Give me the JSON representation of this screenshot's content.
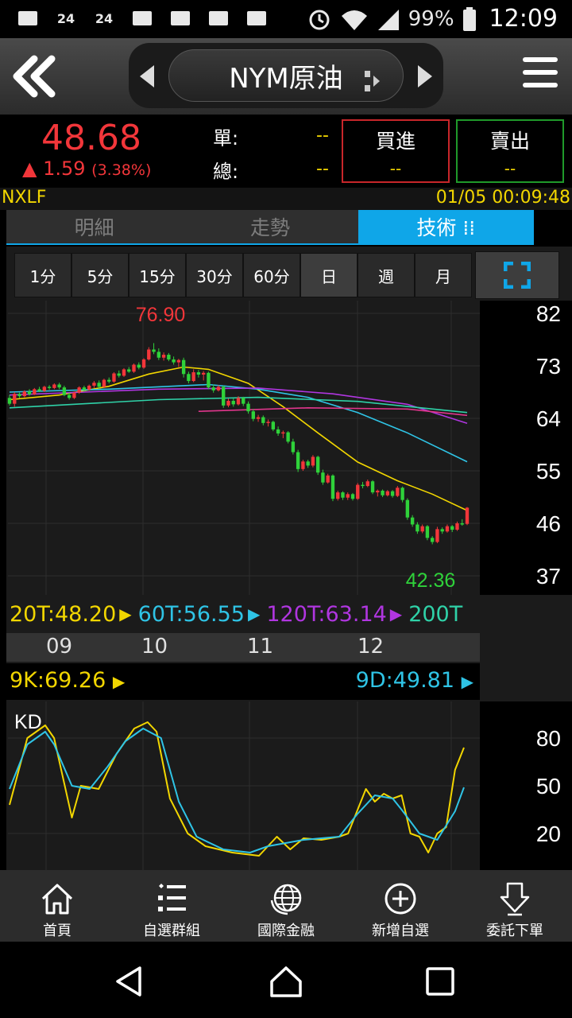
{
  "status_bar": {
    "left_icons": [
      "mail-icon",
      "24h-icon",
      "24h-icon",
      "chat-icon",
      "image-icon",
      "barcode-icon",
      "pinwheel-icon"
    ],
    "left_labels": [
      "",
      "24",
      "24",
      "",
      "",
      "",
      ""
    ],
    "battery": "99%",
    "time": "12:09"
  },
  "header": {
    "title": "NYM原油"
  },
  "quote": {
    "price": "48.68",
    "change": "▲ 1.59",
    "change_pct": "(3.38%)",
    "single_label": "單:",
    "single_value": "--",
    "total_label": "總:",
    "total_value": "--",
    "buy_label": "買進",
    "buy_value": "--",
    "sell_label": "賣出",
    "sell_value": "--"
  },
  "info": {
    "symbol": "NXLF",
    "datetime": "01/05 00:09:48"
  },
  "tabs": [
    {
      "label": "明細"
    },
    {
      "label": "走勢"
    },
    {
      "label": "技術 ⁞⁞"
    }
  ],
  "intervals": [
    "1分",
    "5分",
    "15分",
    "30分",
    "60分",
    "日",
    "週",
    "月"
  ],
  "selected_interval": "日",
  "colors": {
    "up": "#f2363a",
    "down": "#2fd23a",
    "ma20": "#f2d600",
    "ma60": "#2fc4e6",
    "ma120": "#b036e0",
    "ma200": "#2fd2a8",
    "ma_pink": "#e0368c",
    "accent": "#0fa6e8"
  },
  "ma_legend": [
    {
      "text": "20T:48.20",
      "color": "#f2d600"
    },
    {
      "text": "60T:56.55",
      "color": "#2fc4e6"
    },
    {
      "text": "120T:63.14",
      "color": "#b036e0"
    },
    {
      "text": "200T",
      "color": "#2fd2a8"
    }
  ],
  "months": [
    "09",
    "10",
    "11",
    "12"
  ],
  "kd": {
    "k_label": "9K:69.26",
    "d_label": "9D:49.81",
    "title": "KD"
  },
  "bottom_nav": [
    {
      "label": "首頁",
      "icon": "home-icon"
    },
    {
      "label": "自選群組",
      "icon": "list-icon"
    },
    {
      "label": "國際金融",
      "icon": "globe-icon"
    },
    {
      "label": "新增自選",
      "icon": "add-circle-icon"
    },
    {
      "label": "委託下單",
      "icon": "order-down-icon"
    }
  ],
  "chart_data": [
    {
      "type": "candlestick",
      "title": "",
      "ylim": [
        37,
        82
      ],
      "y_ticks": [
        82,
        73,
        64,
        55,
        46,
        37
      ],
      "x_labels": [
        "09",
        "10",
        "11",
        "12"
      ],
      "high_label": "76.90",
      "low_label": "42.36",
      "candles": [
        [
          67.5,
          68.0,
          66.2,
          66.5
        ],
        [
          66.5,
          68.5,
          66.0,
          68.2
        ],
        [
          68.2,
          68.4,
          67.5,
          67.8
        ],
        [
          67.8,
          68.8,
          67.6,
          68.6
        ],
        [
          68.6,
          69.0,
          67.9,
          68.1
        ],
        [
          68.1,
          69.2,
          68.0,
          69.0
        ],
        [
          69.0,
          69.4,
          68.5,
          68.7
        ],
        [
          68.7,
          69.6,
          68.5,
          69.4
        ],
        [
          69.4,
          69.7,
          68.9,
          69.2
        ],
        [
          69.2,
          70.0,
          69.0,
          69.8
        ],
        [
          69.8,
          70.1,
          69.0,
          69.3
        ],
        [
          69.3,
          69.6,
          67.8,
          68.0
        ],
        [
          68.0,
          68.4,
          67.2,
          67.5
        ],
        [
          67.5,
          68.6,
          67.3,
          68.4
        ],
        [
          68.4,
          69.5,
          68.2,
          69.3
        ],
        [
          69.3,
          69.6,
          68.6,
          68.9
        ],
        [
          68.9,
          69.8,
          68.7,
          69.6
        ],
        [
          69.6,
          70.4,
          69.2,
          70.1
        ],
        [
          70.1,
          70.5,
          69.1,
          69.4
        ],
        [
          69.4,
          70.8,
          69.2,
          70.6
        ],
        [
          70.6,
          71.0,
          70.0,
          70.3
        ],
        [
          70.3,
          71.9,
          70.1,
          71.7
        ],
        [
          71.7,
          72.2,
          71.0,
          71.3
        ],
        [
          71.3,
          72.6,
          71.1,
          72.4
        ],
        [
          72.4,
          72.8,
          71.8,
          72.0
        ],
        [
          72.0,
          73.4,
          71.8,
          73.2
        ],
        [
          73.2,
          73.6,
          72.4,
          72.7
        ],
        [
          72.7,
          74.3,
          72.5,
          74.1
        ],
        [
          74.1,
          76.2,
          73.9,
          75.8
        ],
        [
          75.8,
          76.9,
          75.0,
          75.4
        ],
        [
          75.4,
          76.0,
          74.0,
          74.4
        ],
        [
          74.4,
          75.3,
          73.9,
          74.9
        ],
        [
          74.9,
          75.2,
          73.8,
          74.1
        ],
        [
          74.1,
          74.6,
          73.2,
          73.6
        ],
        [
          73.6,
          74.2,
          72.8,
          74.0
        ],
        [
          74.0,
          74.4,
          71.0,
          71.6
        ],
        [
          71.6,
          72.0,
          70.0,
          70.4
        ],
        [
          70.4,
          72.4,
          70.2,
          71.9
        ],
        [
          71.9,
          72.3,
          71.0,
          71.5
        ],
        [
          71.5,
          72.1,
          70.5,
          71.8
        ],
        [
          71.8,
          72.0,
          69.0,
          69.3
        ],
        [
          69.3,
          69.8,
          68.4,
          68.8
        ],
        [
          68.8,
          69.7,
          68.6,
          69.4
        ],
        [
          69.4,
          69.6,
          65.8,
          66.2
        ],
        [
          66.2,
          67.4,
          65.9,
          67.0
        ],
        [
          67.0,
          67.4,
          66.0,
          66.4
        ],
        [
          66.4,
          67.8,
          66.2,
          67.5
        ],
        [
          67.5,
          67.7,
          66.1,
          66.5
        ],
        [
          66.5,
          66.9,
          64.8,
          65.2
        ],
        [
          65.2,
          65.6,
          63.5,
          63.9
        ],
        [
          63.9,
          64.6,
          63.4,
          64.2
        ],
        [
          64.2,
          64.5,
          62.8,
          63.2
        ],
        [
          63.2,
          63.8,
          62.6,
          63.4
        ],
        [
          63.4,
          63.6,
          61.8,
          62.1
        ],
        [
          62.1,
          62.6,
          61.0,
          61.4
        ],
        [
          61.4,
          61.9,
          60.6,
          61.6
        ],
        [
          61.6,
          61.8,
          59.7,
          60.0
        ],
        [
          60.0,
          60.5,
          57.8,
          58.2
        ],
        [
          58.2,
          58.6,
          54.8,
          55.3
        ],
        [
          55.3,
          56.9,
          55.0,
          56.6
        ],
        [
          56.6,
          56.9,
          55.5,
          55.9
        ],
        [
          55.9,
          57.7,
          55.6,
          57.4
        ],
        [
          57.4,
          57.6,
          54.3,
          54.7
        ],
        [
          54.7,
          55.2,
          52.6,
          53.0
        ],
        [
          53.0,
          54.5,
          52.8,
          54.2
        ],
        [
          54.2,
          54.4,
          49.8,
          50.2
        ],
        [
          50.2,
          51.6,
          49.9,
          51.3
        ],
        [
          51.3,
          51.5,
          50.0,
          50.4
        ],
        [
          50.4,
          51.3,
          50.0,
          51.0
        ],
        [
          51.0,
          51.2,
          49.9,
          50.2
        ],
        [
          50.2,
          52.9,
          50.0,
          52.6
        ],
        [
          52.6,
          53.1,
          52.0,
          52.4
        ],
        [
          52.4,
          53.5,
          52.2,
          53.2
        ],
        [
          53.2,
          53.4,
          51.0,
          51.3
        ],
        [
          51.3,
          51.8,
          50.6,
          51.6
        ],
        [
          51.6,
          51.8,
          50.5,
          50.8
        ],
        [
          50.8,
          51.7,
          50.6,
          51.5
        ],
        [
          51.5,
          51.7,
          50.4,
          50.7
        ],
        [
          50.7,
          52.4,
          50.5,
          52.1
        ],
        [
          52.1,
          52.3,
          49.6,
          50.0
        ],
        [
          50.0,
          50.3,
          46.6,
          47.0
        ],
        [
          47.0,
          47.4,
          45.4,
          45.8
        ],
        [
          45.8,
          46.2,
          44.2,
          44.6
        ],
        [
          44.6,
          45.8,
          44.3,
          45.5
        ],
        [
          45.5,
          45.7,
          43.1,
          43.5
        ],
        [
          43.5,
          43.8,
          42.4,
          42.8
        ],
        [
          42.8,
          45.4,
          42.6,
          45.0
        ],
        [
          45.0,
          45.3,
          44.2,
          44.6
        ],
        [
          44.6,
          45.8,
          44.4,
          45.5
        ],
        [
          45.5,
          45.7,
          44.5,
          44.9
        ],
        [
          44.9,
          46.3,
          44.7,
          46.0
        ],
        [
          46.0,
          46.7,
          45.6,
          45.9
        ],
        [
          45.9,
          48.8,
          45.7,
          48.68
        ]
      ],
      "ma_lines": [
        {
          "name": "20T",
          "color": "#f2d600",
          "values": [
            [
              0,
              67.2
            ],
            [
              10,
              68.0
            ],
            [
              20,
              69.5
            ],
            [
              28,
              71.6
            ],
            [
              35,
              72.8
            ],
            [
              40,
              72.4
            ],
            [
              48,
              70.0
            ],
            [
              55,
              66.0
            ],
            [
              62,
              61.5
            ],
            [
              70,
              56.5
            ],
            [
              78,
              53.3
            ],
            [
              85,
              51.0
            ],
            [
              92,
              48.2
            ]
          ]
        },
        {
          "name": "60T",
          "color": "#2fc4e6",
          "values": [
            [
              0,
              68.5
            ],
            [
              20,
              69.0
            ],
            [
              40,
              69.8
            ],
            [
              50,
              69.0
            ],
            [
              60,
              67.6
            ],
            [
              70,
              65.0
            ],
            [
              80,
              61.5
            ],
            [
              92,
              56.55
            ]
          ]
        },
        {
          "name": "120T",
          "color": "#b036e0",
          "values": [
            [
              0,
              68.0
            ],
            [
              30,
              69.0
            ],
            [
              50,
              69.2
            ],
            [
              65,
              68.2
            ],
            [
              80,
              66.4
            ],
            [
              92,
              63.14
            ]
          ]
        },
        {
          "name": "200T",
          "color": "#2fd2a8",
          "values": [
            [
              0,
              65.8
            ],
            [
              30,
              67.2
            ],
            [
              50,
              67.6
            ],
            [
              70,
              66.9
            ],
            [
              92,
              65.0
            ]
          ]
        },
        {
          "name": "",
          "color": "#e0368c",
          "values": [
            [
              38,
              65.2
            ],
            [
              60,
              65.8
            ],
            [
              80,
              65.6
            ],
            [
              92,
              64.5
            ]
          ]
        }
      ]
    },
    {
      "type": "line",
      "title": "KD",
      "ylim": [
        0,
        100
      ],
      "y_ticks": [
        80,
        50,
        20
      ],
      "series": [
        {
          "name": "9K",
          "color": "#f2d600",
          "values": [
            [
              0,
              38
            ],
            [
              4,
              80
            ],
            [
              8,
              88
            ],
            [
              10,
              80
            ],
            [
              14,
              30
            ],
            [
              16,
              50
            ],
            [
              20,
              48
            ],
            [
              24,
              70
            ],
            [
              28,
              86
            ],
            [
              31,
              90
            ],
            [
              33,
              84
            ],
            [
              36,
              42
            ],
            [
              40,
              20
            ],
            [
              44,
              12
            ],
            [
              50,
              8
            ],
            [
              56,
              6
            ],
            [
              60,
              18
            ],
            [
              63,
              10
            ],
            [
              66,
              17
            ],
            [
              70,
              16
            ],
            [
              74,
              18
            ],
            [
              76,
              20
            ],
            [
              80,
              48
            ],
            [
              82,
              40
            ],
            [
              84,
              45
            ],
            [
              86,
              42
            ],
            [
              88,
              44
            ],
            [
              90,
              20
            ],
            [
              92,
              18
            ],
            [
              94,
              8
            ],
            [
              96,
              20
            ],
            [
              98,
              24
            ],
            [
              100,
              60
            ],
            [
              102,
              74
            ]
          ]
        },
        {
          "name": "9D",
          "color": "#2fc4e6",
          "values": [
            [
              0,
              48
            ],
            [
              4,
              76
            ],
            [
              8,
              84
            ],
            [
              10,
              76
            ],
            [
              14,
              50
            ],
            [
              18,
              48
            ],
            [
              22,
              62
            ],
            [
              26,
              78
            ],
            [
              30,
              86
            ],
            [
              34,
              80
            ],
            [
              38,
              40
            ],
            [
              42,
              18
            ],
            [
              48,
              10
            ],
            [
              54,
              8
            ],
            [
              58,
              12
            ],
            [
              62,
              14
            ],
            [
              66,
              16
            ],
            [
              70,
              17
            ],
            [
              74,
              18
            ],
            [
              78,
              32
            ],
            [
              82,
              44
            ],
            [
              86,
              42
            ],
            [
              88,
              35
            ],
            [
              92,
              20
            ],
            [
              96,
              16
            ],
            [
              100,
              34
            ],
            [
              102,
              49
            ]
          ]
        }
      ]
    }
  ]
}
